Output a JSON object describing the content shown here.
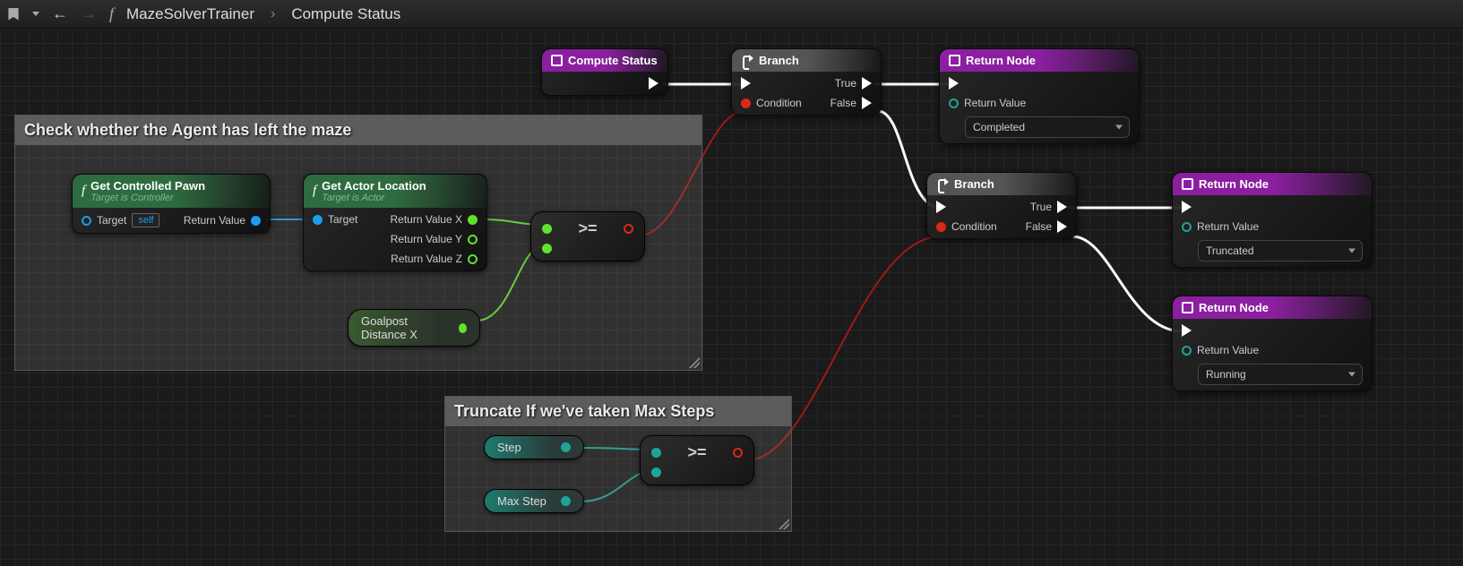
{
  "breadcrumb": {
    "parent": "MazeSolverTrainer",
    "current": "Compute Status"
  },
  "comments": {
    "maze": "Check whether the Agent has left the maze",
    "truncate": "Truncate If we've taken Max Steps"
  },
  "nodes": {
    "compute": {
      "title": "Compute Status"
    },
    "branch1": {
      "title": "Branch",
      "condition": "Condition",
      "true": "True",
      "false": "False"
    },
    "branch2": {
      "title": "Branch",
      "condition": "Condition",
      "true": "True",
      "false": "False"
    },
    "return1": {
      "title": "Return Node",
      "label": "Return Value",
      "value": "Completed"
    },
    "return2": {
      "title": "Return Node",
      "label": "Return Value",
      "value": "Truncated"
    },
    "return3": {
      "title": "Return Node",
      "label": "Return Value",
      "value": "Running"
    },
    "pawn": {
      "title": "Get Controlled Pawn",
      "sub": "Target is Controller",
      "target": "Target",
      "self": "self",
      "return": "Return Value"
    },
    "actor": {
      "title": "Get Actor Location",
      "sub": "Target is Actor",
      "target": "Target",
      "rx": "Return Value X",
      "ry": "Return Value Y",
      "rz": "Return Value Z"
    },
    "op1": ">=",
    "op2": ">=",
    "goalpost": "Goalpost Distance X",
    "step": "Step",
    "maxstep": "Max Step"
  }
}
